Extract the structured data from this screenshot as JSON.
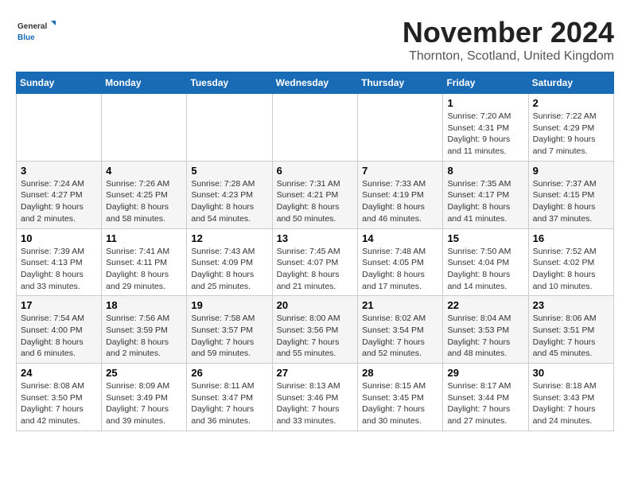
{
  "logo": {
    "general": "General",
    "blue": "Blue"
  },
  "header": {
    "month_title": "November 2024",
    "location": "Thornton, Scotland, United Kingdom"
  },
  "weekdays": [
    "Sunday",
    "Monday",
    "Tuesday",
    "Wednesday",
    "Thursday",
    "Friday",
    "Saturday"
  ],
  "weeks": [
    [
      {
        "day": "",
        "info": ""
      },
      {
        "day": "",
        "info": ""
      },
      {
        "day": "",
        "info": ""
      },
      {
        "day": "",
        "info": ""
      },
      {
        "day": "",
        "info": ""
      },
      {
        "day": "1",
        "info": "Sunrise: 7:20 AM\nSunset: 4:31 PM\nDaylight: 9 hours and 11 minutes."
      },
      {
        "day": "2",
        "info": "Sunrise: 7:22 AM\nSunset: 4:29 PM\nDaylight: 9 hours and 7 minutes."
      }
    ],
    [
      {
        "day": "3",
        "info": "Sunrise: 7:24 AM\nSunset: 4:27 PM\nDaylight: 9 hours and 2 minutes."
      },
      {
        "day": "4",
        "info": "Sunrise: 7:26 AM\nSunset: 4:25 PM\nDaylight: 8 hours and 58 minutes."
      },
      {
        "day": "5",
        "info": "Sunrise: 7:28 AM\nSunset: 4:23 PM\nDaylight: 8 hours and 54 minutes."
      },
      {
        "day": "6",
        "info": "Sunrise: 7:31 AM\nSunset: 4:21 PM\nDaylight: 8 hours and 50 minutes."
      },
      {
        "day": "7",
        "info": "Sunrise: 7:33 AM\nSunset: 4:19 PM\nDaylight: 8 hours and 46 minutes."
      },
      {
        "day": "8",
        "info": "Sunrise: 7:35 AM\nSunset: 4:17 PM\nDaylight: 8 hours and 41 minutes."
      },
      {
        "day": "9",
        "info": "Sunrise: 7:37 AM\nSunset: 4:15 PM\nDaylight: 8 hours and 37 minutes."
      }
    ],
    [
      {
        "day": "10",
        "info": "Sunrise: 7:39 AM\nSunset: 4:13 PM\nDaylight: 8 hours and 33 minutes."
      },
      {
        "day": "11",
        "info": "Sunrise: 7:41 AM\nSunset: 4:11 PM\nDaylight: 8 hours and 29 minutes."
      },
      {
        "day": "12",
        "info": "Sunrise: 7:43 AM\nSunset: 4:09 PM\nDaylight: 8 hours and 25 minutes."
      },
      {
        "day": "13",
        "info": "Sunrise: 7:45 AM\nSunset: 4:07 PM\nDaylight: 8 hours and 21 minutes."
      },
      {
        "day": "14",
        "info": "Sunrise: 7:48 AM\nSunset: 4:05 PM\nDaylight: 8 hours and 17 minutes."
      },
      {
        "day": "15",
        "info": "Sunrise: 7:50 AM\nSunset: 4:04 PM\nDaylight: 8 hours and 14 minutes."
      },
      {
        "day": "16",
        "info": "Sunrise: 7:52 AM\nSunset: 4:02 PM\nDaylight: 8 hours and 10 minutes."
      }
    ],
    [
      {
        "day": "17",
        "info": "Sunrise: 7:54 AM\nSunset: 4:00 PM\nDaylight: 8 hours and 6 minutes."
      },
      {
        "day": "18",
        "info": "Sunrise: 7:56 AM\nSunset: 3:59 PM\nDaylight: 8 hours and 2 minutes."
      },
      {
        "day": "19",
        "info": "Sunrise: 7:58 AM\nSunset: 3:57 PM\nDaylight: 7 hours and 59 minutes."
      },
      {
        "day": "20",
        "info": "Sunrise: 8:00 AM\nSunset: 3:56 PM\nDaylight: 7 hours and 55 minutes."
      },
      {
        "day": "21",
        "info": "Sunrise: 8:02 AM\nSunset: 3:54 PM\nDaylight: 7 hours and 52 minutes."
      },
      {
        "day": "22",
        "info": "Sunrise: 8:04 AM\nSunset: 3:53 PM\nDaylight: 7 hours and 48 minutes."
      },
      {
        "day": "23",
        "info": "Sunrise: 8:06 AM\nSunset: 3:51 PM\nDaylight: 7 hours and 45 minutes."
      }
    ],
    [
      {
        "day": "24",
        "info": "Sunrise: 8:08 AM\nSunset: 3:50 PM\nDaylight: 7 hours and 42 minutes."
      },
      {
        "day": "25",
        "info": "Sunrise: 8:09 AM\nSunset: 3:49 PM\nDaylight: 7 hours and 39 minutes."
      },
      {
        "day": "26",
        "info": "Sunrise: 8:11 AM\nSunset: 3:47 PM\nDaylight: 7 hours and 36 minutes."
      },
      {
        "day": "27",
        "info": "Sunrise: 8:13 AM\nSunset: 3:46 PM\nDaylight: 7 hours and 33 minutes."
      },
      {
        "day": "28",
        "info": "Sunrise: 8:15 AM\nSunset: 3:45 PM\nDaylight: 7 hours and 30 minutes."
      },
      {
        "day": "29",
        "info": "Sunrise: 8:17 AM\nSunset: 3:44 PM\nDaylight: 7 hours and 27 minutes."
      },
      {
        "day": "30",
        "info": "Sunrise: 8:18 AM\nSunset: 3:43 PM\nDaylight: 7 hours and 24 minutes."
      }
    ]
  ]
}
